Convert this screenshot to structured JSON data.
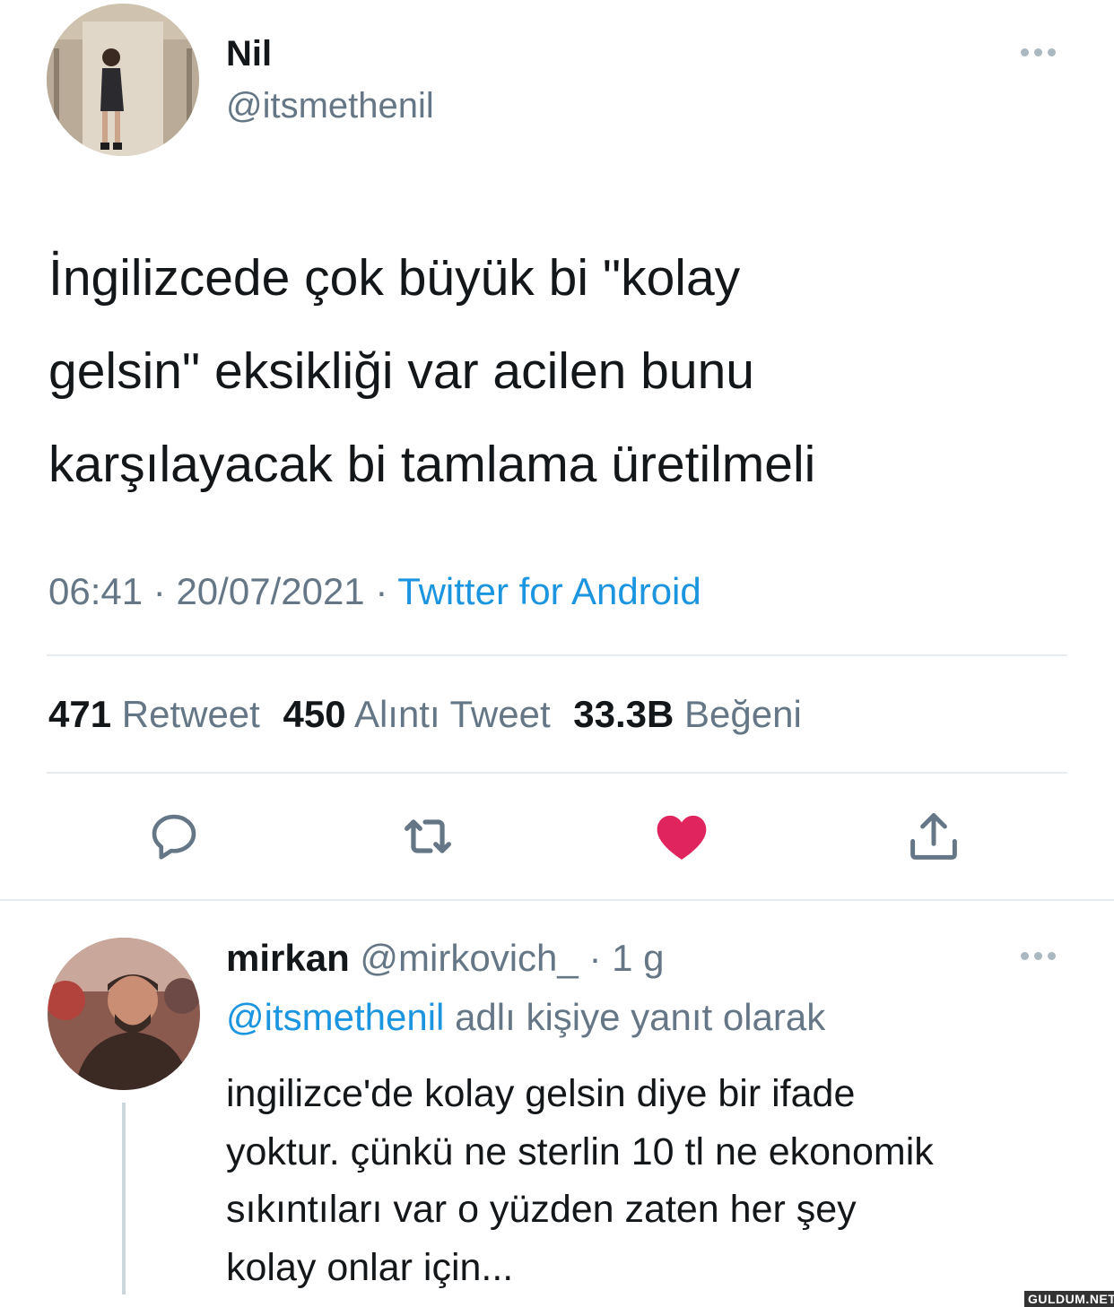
{
  "tweet": {
    "author_name": "Nil",
    "author_handle": "@itsmethenil",
    "text_lines": [
      "İngilizcede çok büyük bi \"kolay",
      "gelsin\" eksikliği var acilen bunu",
      "karşılayacak bi tamlama üretilmeli"
    ],
    "time": "06:41",
    "date": "20/07/2021",
    "separator": "·",
    "source": "Twitter for Android",
    "stats": [
      {
        "count": "471",
        "label": "Retweet"
      },
      {
        "count": "450",
        "label": "Alıntı Tweet"
      },
      {
        "count": "33.3B",
        "label": "Beğeni"
      }
    ],
    "liked": true,
    "like_color": "#e0245e"
  },
  "reply": {
    "author_name": "mirkan",
    "author_handle": "@mirkovich_",
    "separator": "·",
    "age": "1 g",
    "replying_to_handle": "@itsmethenil",
    "replying_to_suffix": "adlı kişiye yanıt olarak",
    "text_lines": [
      "ingilizce'de kolay gelsin diye bir ifade",
      "yoktur. çünkü ne sterlin 10 tl ne ekonomik",
      "sıkıntıları var o yüzden zaten her şey",
      "kolay onlar için..."
    ]
  },
  "watermark": "GULDUM.NET",
  "icons": {
    "more": "more-dots-icon",
    "reply": "reply-icon",
    "retweet": "retweet-icon",
    "like": "heart-icon",
    "share": "share-icon"
  }
}
